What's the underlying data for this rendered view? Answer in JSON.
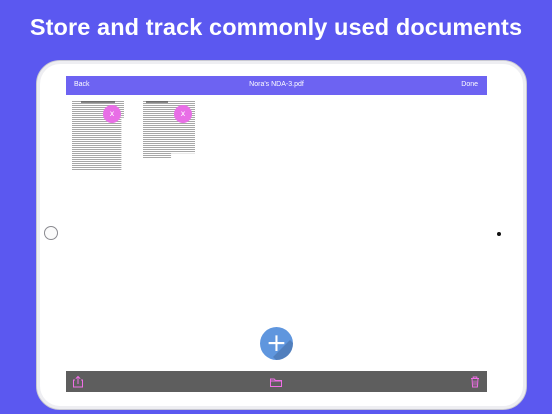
{
  "headline": "Store and track commonly used documents",
  "navbar": {
    "back_label": "Back",
    "title": "Nora's NDA-3.pdf",
    "done_label": "Done",
    "color": "#6d63f2"
  },
  "documents": [
    {
      "close_label": "x"
    },
    {
      "close_label": "x"
    }
  ],
  "fab": {
    "label": "+",
    "color": "#5f96de"
  },
  "toolbar": {
    "icons": [
      "share-icon",
      "folder-icon",
      "trash-icon"
    ],
    "icon_color": "#f06ee6",
    "background": "#5e5e5e"
  },
  "accent_colors": {
    "background": "#5b58f0",
    "delete_button": "#e86ee6"
  }
}
